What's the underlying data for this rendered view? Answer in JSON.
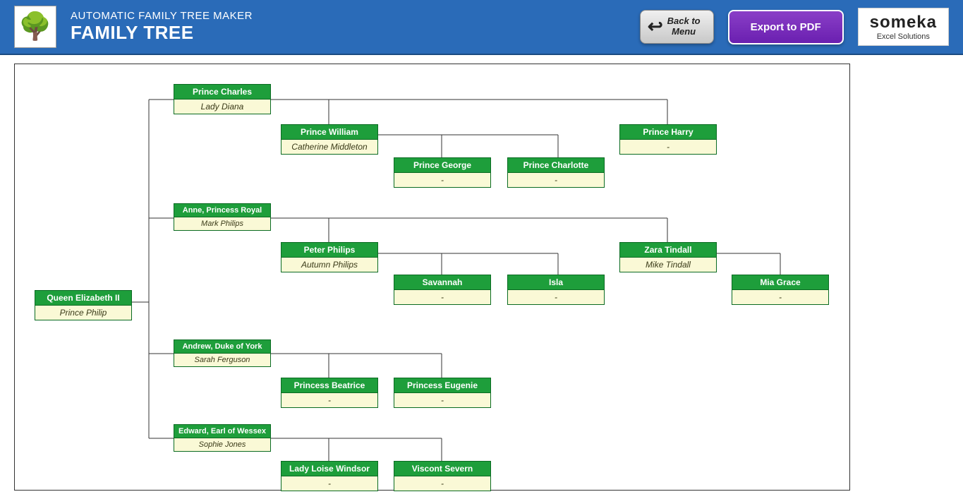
{
  "header": {
    "subtitle": "AUTOMATIC FAMILY TREE MAKER",
    "title": "FAMILY TREE",
    "back_label": "Back to\nMenu",
    "export_label": "Export to PDF",
    "brand_name": "someka",
    "brand_sub": "Excel Solutions"
  },
  "people": {
    "root": {
      "name": "Queen Elizabeth II",
      "spouse": "Prince Philip"
    },
    "charles": {
      "name": "Prince Charles",
      "spouse": "Lady Diana"
    },
    "william": {
      "name": "Prince William",
      "spouse": "Catherine Middleton"
    },
    "george": {
      "name": "Prince George",
      "spouse": "-"
    },
    "charlotte": {
      "name": "Prince Charlotte",
      "spouse": "-"
    },
    "harry": {
      "name": "Prince Harry",
      "spouse": "-"
    },
    "anne": {
      "name": "Anne, Princess Royal",
      "spouse": "Mark Philips"
    },
    "peter": {
      "name": "Peter Philips",
      "spouse": "Autumn Philips"
    },
    "savannah": {
      "name": "Savannah",
      "spouse": "-"
    },
    "isla": {
      "name": "Isla",
      "spouse": "-"
    },
    "zara": {
      "name": "Zara Tindall",
      "spouse": "Mike Tindall"
    },
    "mia": {
      "name": "Mia Grace",
      "spouse": "-"
    },
    "andrew": {
      "name": "Andrew, Duke of York",
      "spouse": "Sarah Ferguson"
    },
    "beatrice": {
      "name": "Princess Beatrice",
      "spouse": "-"
    },
    "eugenie": {
      "name": "Princess Eugenie",
      "spouse": "-"
    },
    "edward": {
      "name": "Edward, Earl of Wessex",
      "spouse": "Sophie Jones"
    },
    "loise": {
      "name": "Lady Loise Windsor",
      "spouse": "-"
    },
    "severn": {
      "name": "Viscont Severn",
      "spouse": "-"
    }
  }
}
